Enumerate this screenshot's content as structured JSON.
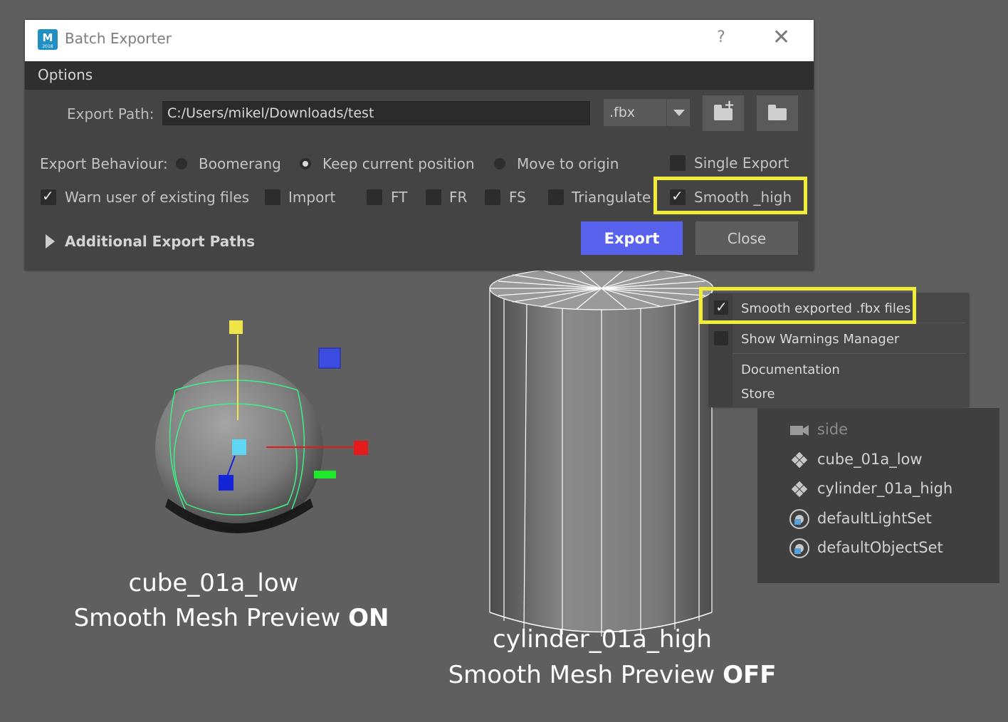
{
  "dialog": {
    "title": "Batch Exporter",
    "app_icon_letter": "M",
    "app_icon_sub": "2018",
    "help_glyph": "?",
    "close_glyph": "✕",
    "menu": [
      "Options"
    ],
    "export_path_label": "Export Path:",
    "export_path_value": "C:/Users/mikel/Downloads/test",
    "format_value": ".fbx",
    "export_behaviour_label": "Export Behaviour:",
    "behaviour_options": [
      {
        "label": "Boomerang",
        "selected": false
      },
      {
        "label": "Keep current position",
        "selected": true
      },
      {
        "label": "Move to origin",
        "selected": false
      }
    ],
    "checkboxes": [
      {
        "label": "Single Export",
        "checked": false
      },
      {
        "label": "Warn user of existing files",
        "checked": true
      },
      {
        "label": "Import",
        "checked": false
      },
      {
        "label": "FT",
        "checked": false
      },
      {
        "label": "FR",
        "checked": false
      },
      {
        "label": "FS",
        "checked": false
      },
      {
        "label": "Triangulate",
        "checked": false
      },
      {
        "label": "Smooth _high",
        "checked": true
      }
    ],
    "additional_paths_label": "Additional Export Paths",
    "export_button": "Export",
    "close_button": "Close",
    "highlight_color": "#f1ec3a",
    "export_button_color": "#5962ec"
  },
  "context_menu": {
    "items": [
      {
        "label": "Smooth exported .fbx files",
        "checked": true
      },
      {
        "label": "Show Warnings Manager",
        "checked": false
      },
      {
        "label": "Documentation"
      },
      {
        "label": "Store"
      }
    ]
  },
  "outliner": {
    "items": [
      {
        "label": "side",
        "icon": "camera-icon",
        "dimmed": true
      },
      {
        "label": "cube_01a_low",
        "icon": "mesh-transform-icon"
      },
      {
        "label": "cylinder_01a_high",
        "icon": "mesh-transform-icon"
      },
      {
        "label": "defaultLightSet",
        "icon": "set-icon"
      },
      {
        "label": "defaultObjectSet",
        "icon": "set-icon"
      }
    ]
  },
  "captions": {
    "left_line1": "cube_01a_low",
    "left_line2_prefix": "Smooth Mesh Preview ",
    "left_line2_bold": "ON",
    "right_line1": "cylinder_01a_high",
    "right_line2_prefix": "Smooth Mesh Preview ",
    "right_line2_bold": "OFF"
  },
  "viewport": {
    "background": "#5f5f5f",
    "manipulator_colors": {
      "x": "#e51a1a",
      "y": "#f0e64a",
      "z": "#1424d8",
      "center": "#5fd7f2",
      "plane": "#3c4be0",
      "wire": "#3ef08a"
    }
  }
}
